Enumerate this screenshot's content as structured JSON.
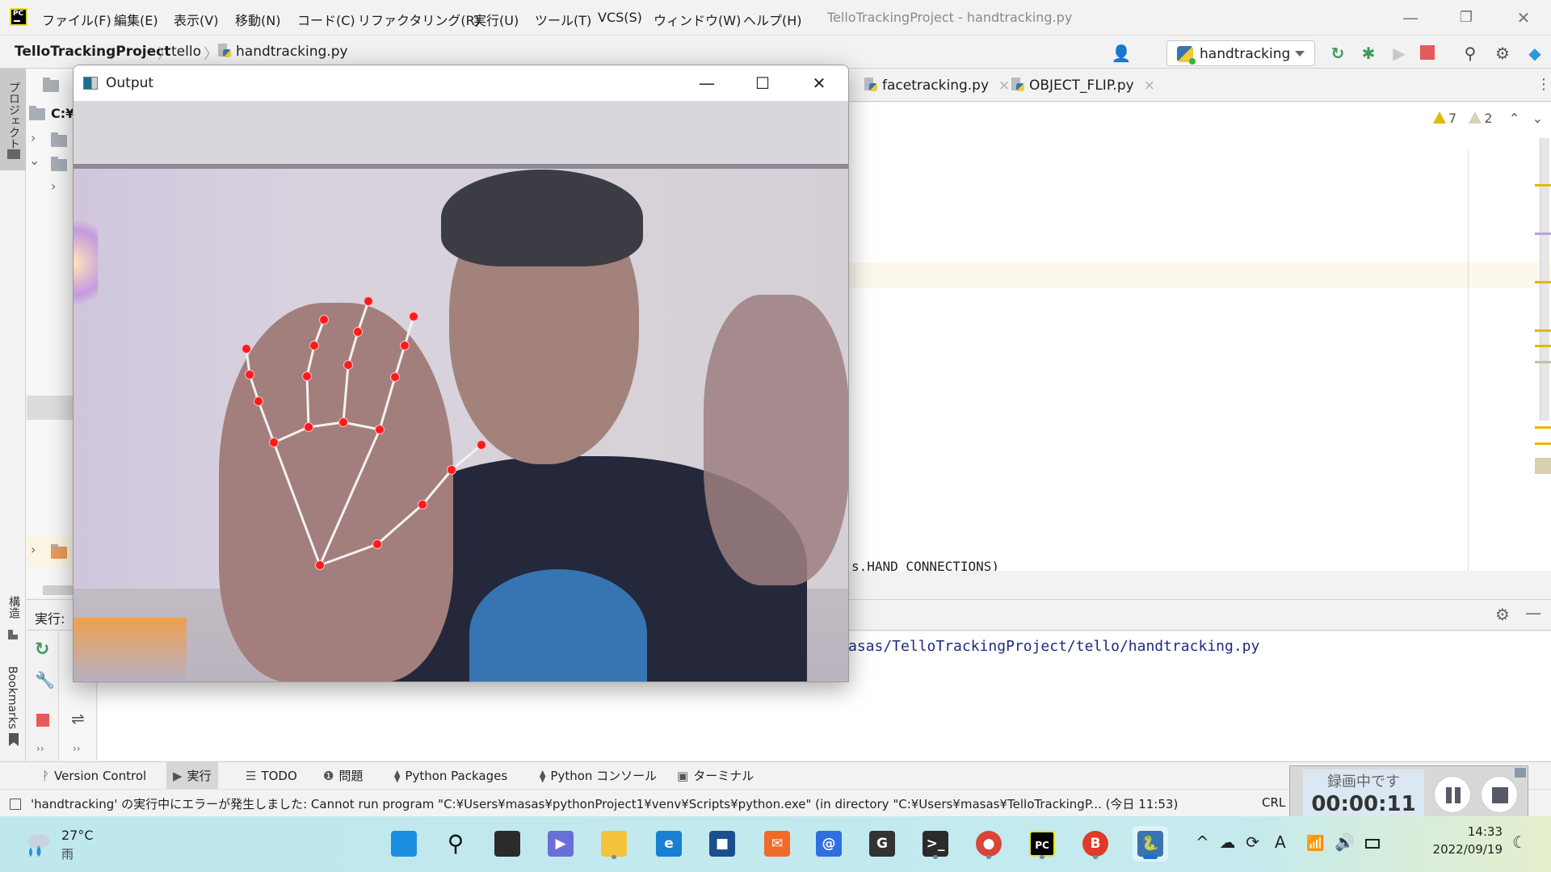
{
  "menubar": {
    "items": [
      "ファイル(F)",
      "編集(E)",
      "表示(V)",
      "移動(N)",
      "コード(C)",
      "リファクタリング(R)",
      "実行(U)",
      "ツール(T)",
      "VCS(S)",
      "ウィンドウ(W)",
      "ヘルプ(H)"
    ],
    "window_title": "TelloTrackingProject - handtracking.py",
    "controls": {
      "minimize": "—",
      "restore": "❐",
      "close": "✕"
    }
  },
  "navbar": {
    "breadcrumbs": [
      "TelloTrackingProject",
      "tello",
      "handtracking.py"
    ],
    "run_config": "handtracking",
    "icons": [
      "user-icon",
      "rerun-icon",
      "debug-icon",
      "coverage-icon",
      "stop-icon",
      "search-icon",
      "settings-icon",
      "code-with-me-icon"
    ]
  },
  "left_strip": {
    "project_label": "プロジェクト",
    "structure_label": "構造",
    "bookmarks_label": "Bookmarks"
  },
  "project_panel": {
    "root_label": "C:¥"
  },
  "editor": {
    "tabs": [
      {
        "label": "facetracking.py",
        "close": "×"
      },
      {
        "label": "OBJECT_FLIP.py",
        "close": "×"
      }
    ],
    "inspections": {
      "warnings": "7",
      "weak_warnings": "2"
    },
    "code_fragment": "s.HAND_CONNECTIONS)"
  },
  "run_panel": {
    "label": "実行:",
    "console_line": "asas/TelloTrackingProject/tello/handtracking.py"
  },
  "tool_tabs": [
    {
      "label": "Version Control",
      "icon": "version-control-icon",
      "active": false
    },
    {
      "label": "実行",
      "icon": "run-icon",
      "active": true
    },
    {
      "label": "TODO",
      "icon": "todo-icon",
      "active": false
    },
    {
      "label": "問題",
      "icon": "problems-icon",
      "active": false
    },
    {
      "label": "Python Packages",
      "icon": "packages-icon",
      "active": false
    },
    {
      "label": "Python コンソール",
      "icon": "python-console-icon",
      "active": false
    },
    {
      "label": "ターミナル",
      "icon": "terminal-icon",
      "active": false
    }
  ],
  "statusbar": {
    "message": "'handtracking' の実行中にエラーが発生しました: Cannot run program \"C:¥Users¥masas¥pythonProject1¥venv¥Scripts¥python.exe\" (in directory \"C:¥Users¥masas¥TelloTrackingP... (今日 11:53)",
    "line_ending": "CRL"
  },
  "recorder": {
    "status": "録画中です",
    "elapsed": "00:00:11"
  },
  "output_window": {
    "title": "Output",
    "controls": {
      "minimize": "—",
      "maximize": "☐",
      "close": "✕"
    },
    "landmark_color": "#ff1a1a",
    "connection_color": "#f2f2f2"
  },
  "taskbar": {
    "weather": {
      "temp": "27°C",
      "condition": "雨"
    },
    "apps": [
      {
        "name": "start",
        "glyph": "",
        "color": "#1a8fe0"
      },
      {
        "name": "search",
        "glyph": "⚲",
        "color": "transparent"
      },
      {
        "name": "task-view",
        "glyph": "",
        "color": "#2b2b2b"
      },
      {
        "name": "teams",
        "glyph": "▶",
        "color": "#6a6fd8"
      },
      {
        "name": "file-explorer",
        "glyph": "",
        "color": "#f3c43a"
      },
      {
        "name": "edge",
        "glyph": "e",
        "color": "#1a7fd0"
      },
      {
        "name": "store",
        "glyph": "■",
        "color": "#1b4e8c"
      },
      {
        "name": "mail-app",
        "glyph": "✉",
        "color": "#f06a2a"
      },
      {
        "name": "at-menu",
        "glyph": "@",
        "color": "#2f6fe0"
      },
      {
        "name": "g-app",
        "glyph": "G",
        "color": "#333333"
      },
      {
        "name": "terminal",
        "glyph": ">_",
        "color": "#2b2b2b"
      },
      {
        "name": "chrome",
        "glyph": "●",
        "color": "#db4437"
      },
      {
        "name": "pycharm",
        "glyph": "PC",
        "color": "#000000"
      },
      {
        "name": "bandicam",
        "glyph": "B",
        "color": "#e03a2a"
      },
      {
        "name": "python",
        "glyph": "🐍",
        "color": "#3a74b0"
      }
    ],
    "tray": [
      "^",
      "☁",
      "⟳",
      "A",
      "wifi",
      "🔊",
      "battery"
    ],
    "time": "14:33",
    "date": "2022/09/19"
  }
}
